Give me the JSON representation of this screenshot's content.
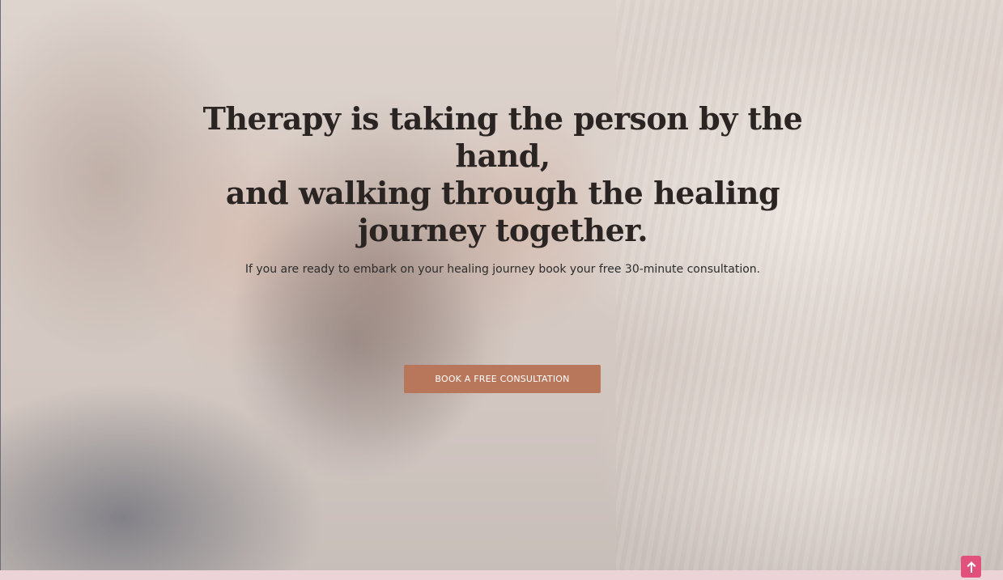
{
  "hero": {
    "headline_line1": "Therapy is taking the person by the hand,",
    "headline_line2": "and walking through the healing",
    "headline_line3": "journey together.",
    "subtext": "If you are ready to embark on your healing journey book your free 30-minute consultation.",
    "cta_label": "BOOK A FREE CONSULTATION",
    "background_image": "hands-holding-mug-photo"
  },
  "scroll_top": {
    "icon": "arrow-up-icon"
  },
  "colors": {
    "cta_background": "#b8765a",
    "scroll_top_background": "#e2507c",
    "footer_strip": "#ecd3d8",
    "headline": "#2a2422"
  }
}
